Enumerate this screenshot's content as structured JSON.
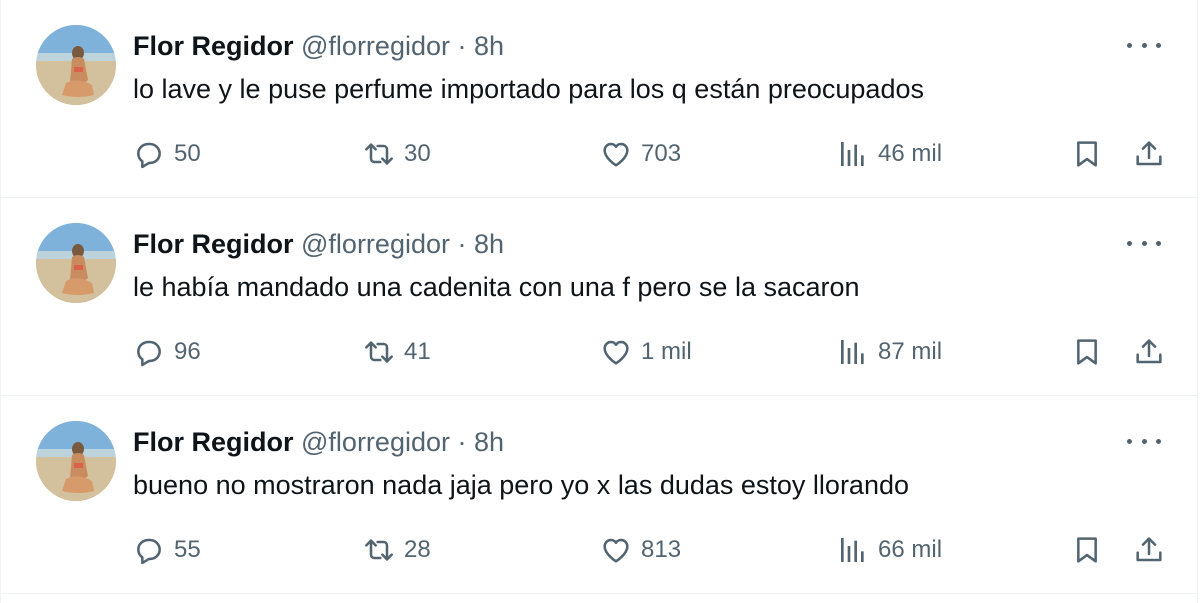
{
  "tweets": [
    {
      "author": "Flor Regidor",
      "handle": "@florregidor",
      "separator": "·",
      "time": "8h",
      "text": "lo lave y le puse perfume importado para los q están preocupados",
      "replies": "50",
      "retweets": "30",
      "likes": "703",
      "views": "46 mil"
    },
    {
      "author": "Flor Regidor",
      "handle": "@florregidor",
      "separator": "·",
      "time": "8h",
      "text": "le había mandado una cadenita con una f pero se la sacaron",
      "replies": "96",
      "retweets": "41",
      "likes": "1 mil",
      "views": "87 mil"
    },
    {
      "author": "Flor Regidor",
      "handle": "@florregidor",
      "separator": "·",
      "time": "8h",
      "text": "bueno no mostraron nada jaja pero yo x las dudas estoy llorando",
      "replies": "55",
      "retweets": "28",
      "likes": "813",
      "views": "66 mil"
    }
  ],
  "colors": {
    "text": "#0f1419",
    "secondary": "#536471",
    "border": "#eff3f4"
  },
  "icons": [
    "reply-icon",
    "retweet-icon",
    "like-icon",
    "views-icon",
    "bookmark-icon",
    "share-icon",
    "more-icon"
  ]
}
